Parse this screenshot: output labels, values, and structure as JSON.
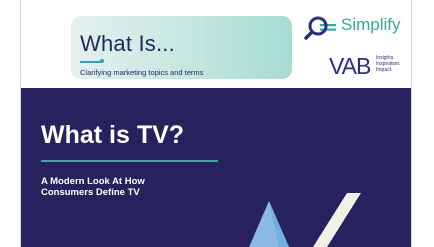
{
  "header": {
    "title": "What Is...",
    "subtitle": "Clarifying marketing topics and terms"
  },
  "brands": {
    "simplify": "Simplify",
    "vab": "VAB",
    "vab_tagline": [
      "Insights.",
      "Inspiration.",
      "Impact."
    ]
  },
  "hero": {
    "title": "What is TV?",
    "subtitle_lines": [
      "A Modern Look At How",
      "Consumers Define TV"
    ]
  },
  "colors": {
    "hero_bg": "#27225d",
    "accent_teal": "#3aa6a0",
    "brand_navy": "#2b2f7a"
  },
  "icons": [
    "magnifier-icon"
  ]
}
